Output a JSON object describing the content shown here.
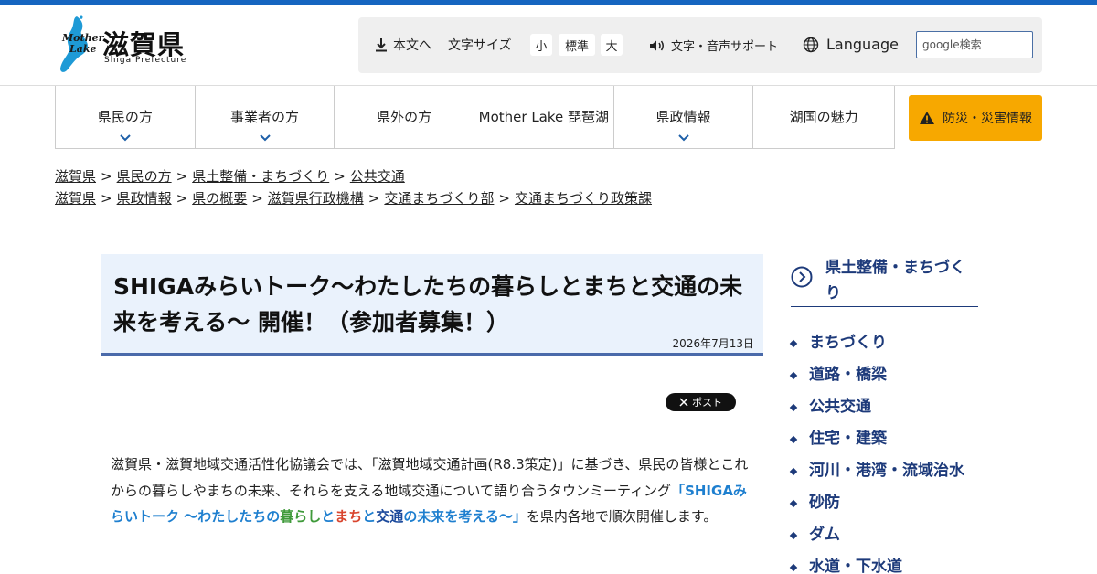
{
  "header": {
    "logo": {
      "mother": "Mother",
      "lake": "Lake",
      "name": "滋賀県",
      "sub": "Shiga Prefecture"
    },
    "tools": {
      "skip_label": "本文へ",
      "text_size_label": "文字サイズ",
      "size_small": "小",
      "size_standard": "標準",
      "size_large": "大",
      "voice_label": "文字・音声サポート",
      "language_label": "Language",
      "search_placeholder": "google検索"
    }
  },
  "nav": {
    "items": [
      {
        "label": "県民の方",
        "has_dropdown": true
      },
      {
        "label": "事業者の方",
        "has_dropdown": true
      },
      {
        "label": "県外の方",
        "has_dropdown": false
      },
      {
        "label": "Mother Lake 琵琶湖",
        "has_dropdown": false
      },
      {
        "label": "県政情報",
        "has_dropdown": true
      },
      {
        "label": "湖国の魅力",
        "has_dropdown": false
      }
    ],
    "disaster_label": "防災・災害情報"
  },
  "breadcrumbs": [
    [
      "滋賀県",
      "県民の方",
      "県土整備・まちづくり",
      "公共交通"
    ],
    [
      "滋賀県",
      "県政情報",
      "県の概要",
      "滋賀県行政機構",
      "交通まちづくり部",
      "交通まちづくり政策課"
    ]
  ],
  "breadcrumb_separator": ">",
  "article": {
    "title": "SHIGAみらいトーク〜わたしたちの暮らしとまちと交通の未来を考える〜 開催！（参加者募集！）",
    "date": "2026年7月13日",
    "x_post_label": "ポスト",
    "body_1": "滋賀県・滋賀地域交通活性化協議会では、「滋賀地域交通計画(R8.3策定)」に基づき、県民の皆様とこれからの暮らしやまちの未来、それらを支える地域交通について語り合うタウンミーティング",
    "highlight": {
      "part1": "「SHIGAみらいトーク 〜わたしたちの",
      "part2": "暮らし",
      "part3": "と",
      "part4": "まち",
      "part5": "と",
      "part6": "交通",
      "part7": "の未来を考える〜」"
    },
    "body_2": "を県内各地で順次開催します。"
  },
  "sidebar": {
    "heading": "県土整備・まちづくり",
    "items": [
      "まちづくり",
      "道路・橋梁",
      "公共交通",
      "住宅・建築",
      "河川・港湾・流域治水",
      "砂防",
      "ダム",
      "水道・下水道"
    ]
  },
  "colors": {
    "accent_blue": "#1565c0",
    "sidebar_navy": "#1d3a7a",
    "disaster_orange": "#f7a800",
    "title_bg": "#eaf2fc"
  }
}
